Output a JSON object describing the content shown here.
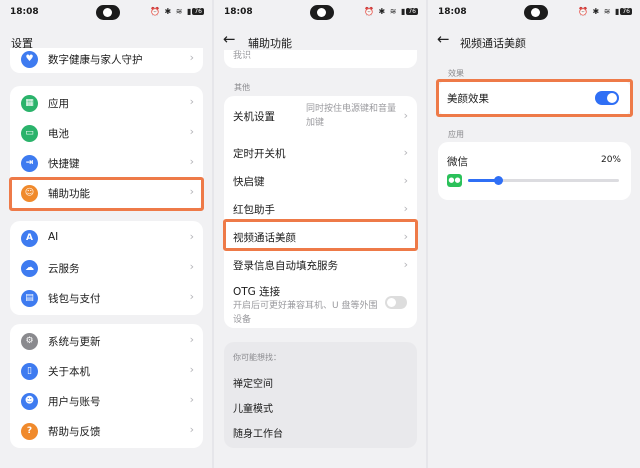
{
  "status": {
    "time": "18:08",
    "battery": "76"
  },
  "settings": {
    "title": "设置",
    "top_item": "数字健康与家人守护",
    "group1": [
      "应用",
      "电池",
      "快捷键",
      "辅助功能"
    ],
    "group2": [
      "AI",
      "云服务",
      "钱包与支付"
    ],
    "group3": [
      "系统与更新",
      "关于本机",
      "用户与账号",
      "帮助与反馈"
    ],
    "colors": {
      "digital": "#3e7bf0",
      "apps": "#2bb36b",
      "battery": "#2bb36b",
      "shortcut": "#3e7bf0",
      "accessibility": "#f08a2c",
      "ai": "#3e7bf0",
      "cloud": "#3e7bf0",
      "wallet": "#3e7bf0",
      "system": "#8a8a8e",
      "about": "#3e7bf0",
      "account": "#3e7bf0",
      "help": "#f08a2c"
    }
  },
  "accessibility": {
    "title": "辅助功能",
    "cut_item": "我识",
    "section_other": "其他",
    "items": {
      "power_settings": {
        "label": "关机设置",
        "desc": "同时按住电源键和音量加键"
      },
      "timed_power": "定时开关机",
      "quick_launch": "快启键",
      "red_packet": "红包助手",
      "video_beauty": "视频通话美颜",
      "autofill": "登录信息自动填充服务",
      "otg": {
        "label": "OTG 连接",
        "desc": "开启后可更好兼容耳机、U 盘等外围设备"
      }
    },
    "suggestions": {
      "title": "你可能想找：",
      "items": [
        "禅定空间",
        "儿童模式",
        "随身工作台"
      ]
    }
  },
  "video_beauty": {
    "title": "视频通话美颜",
    "section_effect": "效果",
    "effect_label": "美颜效果",
    "effect_on": true,
    "section_apps": "应用",
    "app": {
      "name": "微信",
      "level_percent": 20,
      "level_label": "20%"
    }
  },
  "accent_color": "#2f6ff5",
  "highlight_color": "#ee7a48"
}
